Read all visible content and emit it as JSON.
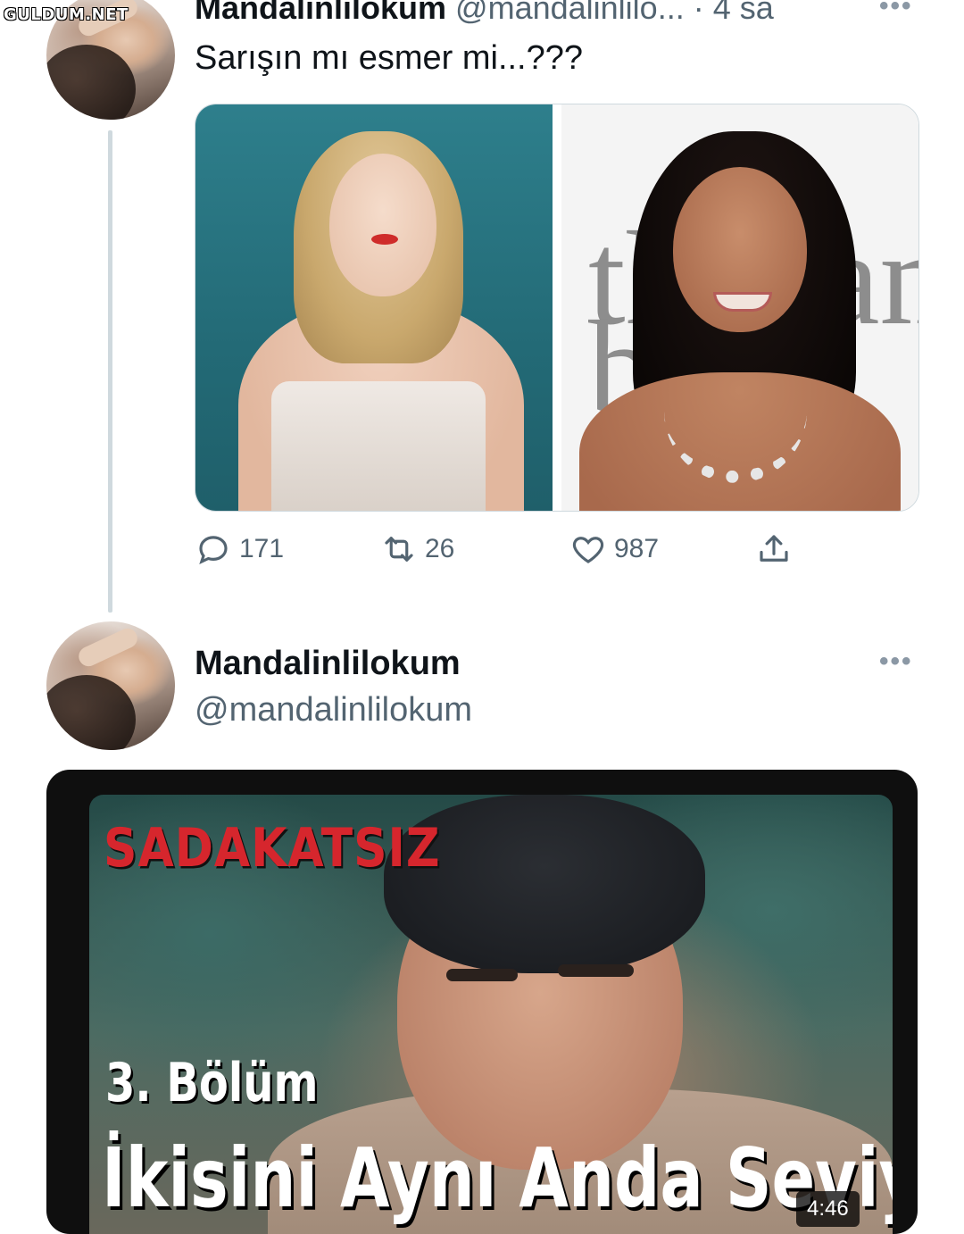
{
  "watermark": "GULDUM.NET",
  "tweet1": {
    "author_name": "Mandalinlilokum",
    "handle": "@mandalinlilo...",
    "separator": "·",
    "time": "4 sa",
    "text": "Sarışın mı esmer mi...???",
    "photo_right_text": "th",
    "photo_right_text2": "am",
    "photo_right_text3": "b",
    "actions": {
      "replies": "171",
      "retweets": "26",
      "likes": "987"
    }
  },
  "tweet2": {
    "author_name": "Mandalinlilokum",
    "handle": "@mandalinlilokum",
    "video": {
      "show_title": "SADAKATSIZ",
      "episode": "3. Bölüm",
      "caption": "İkisini Aynı Anda Seviyorum",
      "duration": "4:46"
    }
  },
  "icons": {
    "more": "more-dots-icon",
    "reply": "reply-icon",
    "retweet": "retweet-icon",
    "like": "heart-icon",
    "share": "share-icon"
  },
  "colors": {
    "secondary_text": "#536471",
    "thread_line": "#cfd9de",
    "video_title_red": "#d6262d"
  }
}
